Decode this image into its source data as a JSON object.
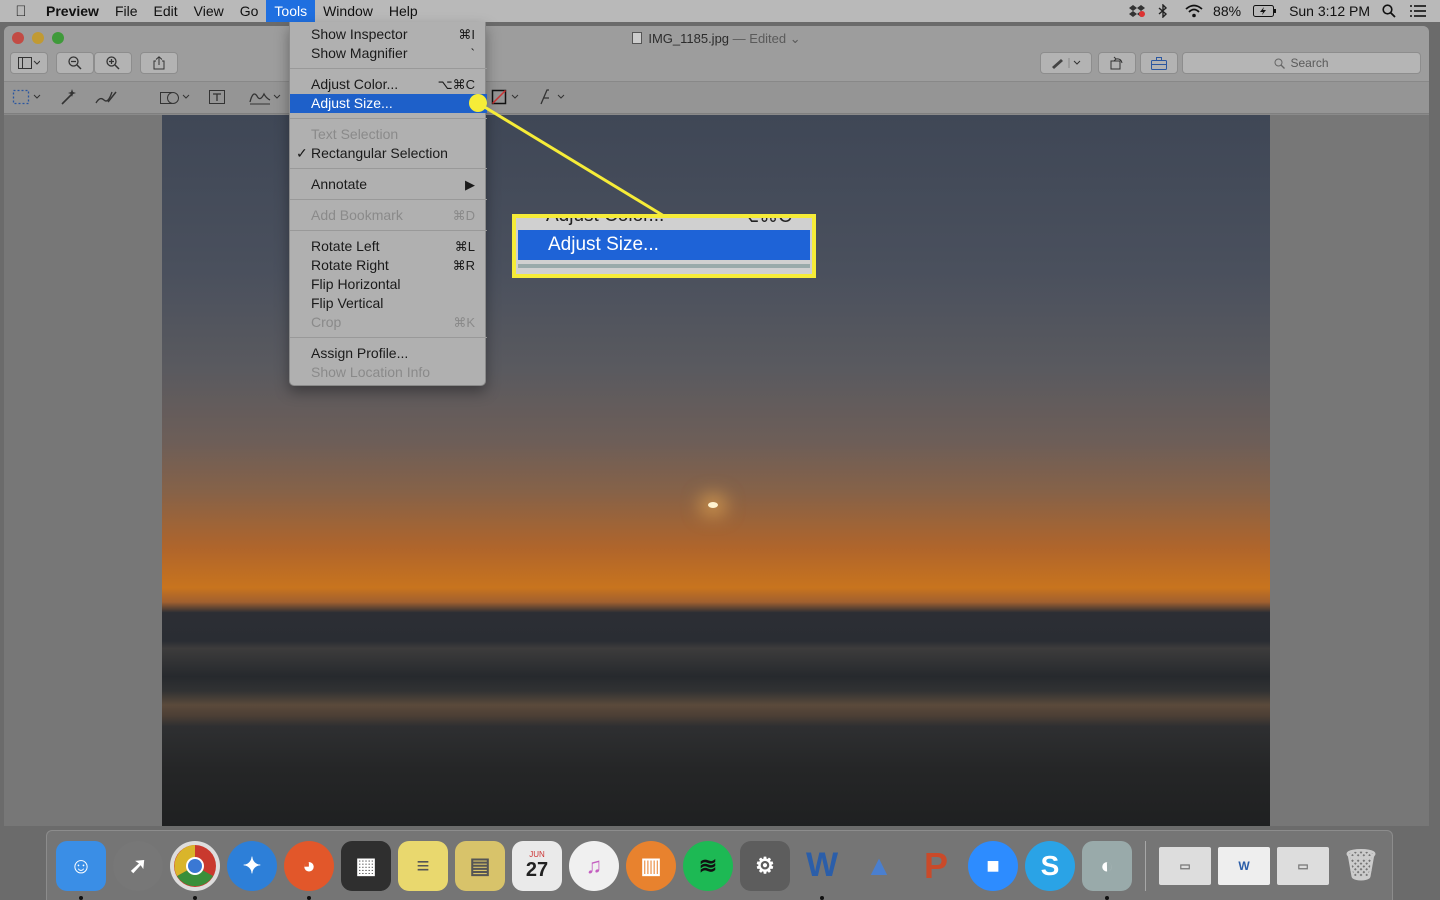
{
  "menubar": {
    "app": "Preview",
    "menus": [
      "File",
      "Edit",
      "View",
      "Go",
      "Tools",
      "Window",
      "Help"
    ],
    "active_menu": "Tools",
    "battery": "88%",
    "clock": "Sun 3:12 PM"
  },
  "window": {
    "filename": "IMG_1185.jpg",
    "status": "— Edited",
    "search_placeholder": "Search"
  },
  "tools_menu": {
    "items": [
      {
        "label": "Show Inspector",
        "shortcut": "⌘I",
        "disabled": false
      },
      {
        "label": "Show Magnifier",
        "shortcut": "`",
        "disabled": false
      },
      {
        "label": "Adjust Color...",
        "shortcut": "⌥⌘C",
        "disabled": false
      },
      {
        "label": "Adjust Size...",
        "shortcut": "",
        "disabled": false,
        "selected": true
      },
      {
        "label": "Text Selection",
        "shortcut": "",
        "disabled": true
      },
      {
        "label": "Rectangular Selection",
        "shortcut": "",
        "disabled": false,
        "checked": true
      },
      {
        "label": "Annotate",
        "shortcut": "▶",
        "disabled": false
      },
      {
        "label": "Add Bookmark",
        "shortcut": "⌘D",
        "disabled": true
      },
      {
        "label": "Rotate Left",
        "shortcut": "⌘L",
        "disabled": false
      },
      {
        "label": "Rotate Right",
        "shortcut": "⌘R",
        "disabled": false
      },
      {
        "label": "Flip Horizontal",
        "shortcut": "",
        "disabled": false
      },
      {
        "label": "Flip Vertical",
        "shortcut": "",
        "disabled": false
      },
      {
        "label": "Crop",
        "shortcut": "⌘K",
        "disabled": true
      },
      {
        "label": "Assign Profile...",
        "shortcut": "",
        "disabled": false
      },
      {
        "label": "Show Location Info",
        "shortcut": "",
        "disabled": true
      }
    ]
  },
  "callout": {
    "label": "Adjust Size...",
    "faded_label": "Adjust Color...",
    "faded_shortcut": "⌥⌘C",
    "color": "#f6ec38"
  },
  "dock": {
    "apps": [
      {
        "name": "Finder",
        "glyph": "☺",
        "color": "#3a8ee6",
        "running": true
      },
      {
        "name": "Launchpad",
        "glyph": "🚀",
        "color": "#777",
        "running": false
      },
      {
        "name": "Chrome",
        "glyph": "◉",
        "color": "#d8d8d8",
        "running": true
      },
      {
        "name": "Safari",
        "glyph": "✦",
        "color": "#2d7fd8",
        "running": false
      },
      {
        "name": "Firefox",
        "glyph": "◕",
        "color": "#e2572a",
        "running": true
      },
      {
        "name": "Photo Booth",
        "glyph": "▦",
        "color": "#333",
        "running": false
      },
      {
        "name": "Notes",
        "glyph": "≡",
        "color": "#e9d86e",
        "running": false
      },
      {
        "name": "Stickies",
        "glyph": "▤",
        "color": "#d8c36a",
        "running": false
      },
      {
        "name": "Calendar",
        "glyph": "27",
        "color": "#eaeaea",
        "running": false
      },
      {
        "name": "iTunes",
        "glyph": "♫",
        "color": "#d97bd3",
        "running": false
      },
      {
        "name": "iBooks",
        "glyph": "▥",
        "color": "#e8822e",
        "running": false
      },
      {
        "name": "Spotify",
        "glyph": "≋",
        "color": "#1db954",
        "running": false
      },
      {
        "name": "System Preferences",
        "glyph": "⚙",
        "color": "#666",
        "running": false
      },
      {
        "name": "Word",
        "glyph": "W",
        "color": "#2b5ea9",
        "running": true
      },
      {
        "name": "Keynote",
        "glyph": "▲",
        "color": "#4a7fcf",
        "running": false
      },
      {
        "name": "PowerPoint",
        "glyph": "P",
        "color": "#c94a2a",
        "running": false
      },
      {
        "name": "Zoom",
        "glyph": "■",
        "color": "#2d8cff",
        "running": false
      },
      {
        "name": "Skype",
        "glyph": "S",
        "color": "#2aa3e6",
        "running": false
      },
      {
        "name": "Preview",
        "glyph": "◐",
        "color": "#9aa",
        "running": true
      }
    ],
    "docs": [
      {
        "name": "Chrome window 1",
        "color": "#ddd"
      },
      {
        "name": "Word document",
        "color": "#eee"
      },
      {
        "name": "Chrome window 2",
        "color": "#ddd"
      },
      {
        "name": "Trash",
        "color": "#bbb"
      }
    ]
  }
}
